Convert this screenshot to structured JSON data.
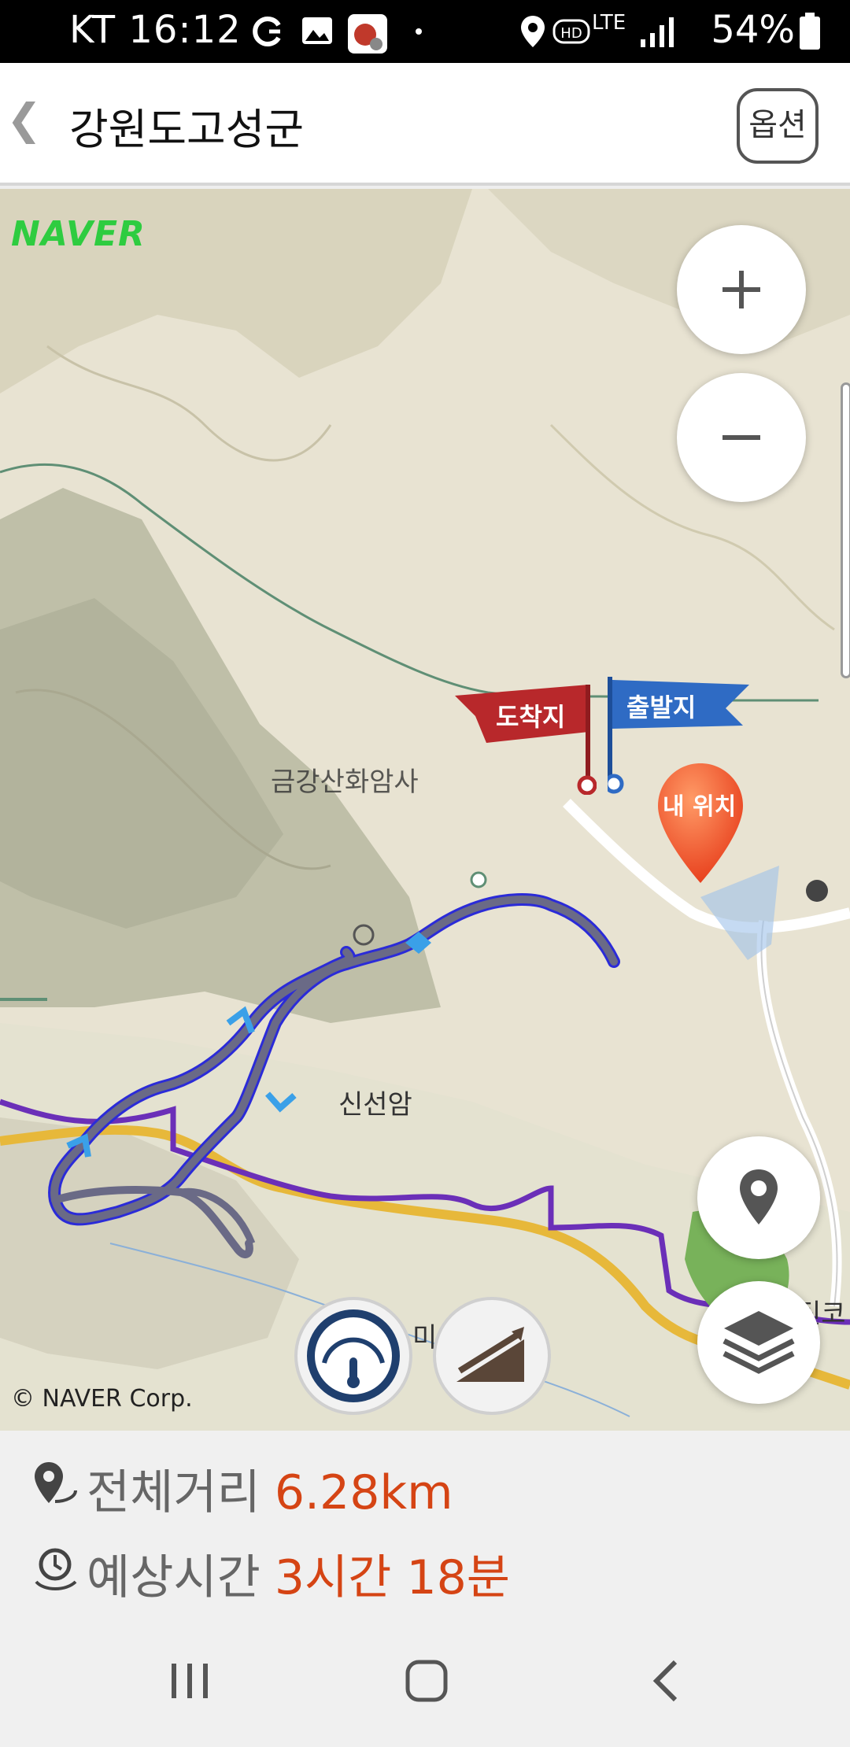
{
  "status_bar": {
    "carrier_time": "KT 16:12",
    "network": "LTE",
    "battery": "54%"
  },
  "header": {
    "back_icon": "chevron-left-icon",
    "title": "강원도고성군",
    "options_label": "옵션"
  },
  "map": {
    "provider_logo": "NAVER",
    "copyright": "© NAVER Corp.",
    "labels": {
      "temple": "금강산화암사",
      "hermitage": "신선암",
      "partial_bottom": "미",
      "partial_right": "틴코"
    },
    "markers": {
      "arrival": "도착지",
      "departure": "출발지",
      "my_location": "내 위치"
    }
  },
  "route_info": {
    "distance_label": "전체거리",
    "distance_value": "6.28km",
    "time_label": "예상시간",
    "time_value": "3시간 18분"
  },
  "colors": {
    "route": "#5a5a86",
    "route_outline": "#2b2bd8",
    "arrival_flag": "#b8282b",
    "departure_flag": "#2f6bc4",
    "accent_value": "#d54414"
  }
}
